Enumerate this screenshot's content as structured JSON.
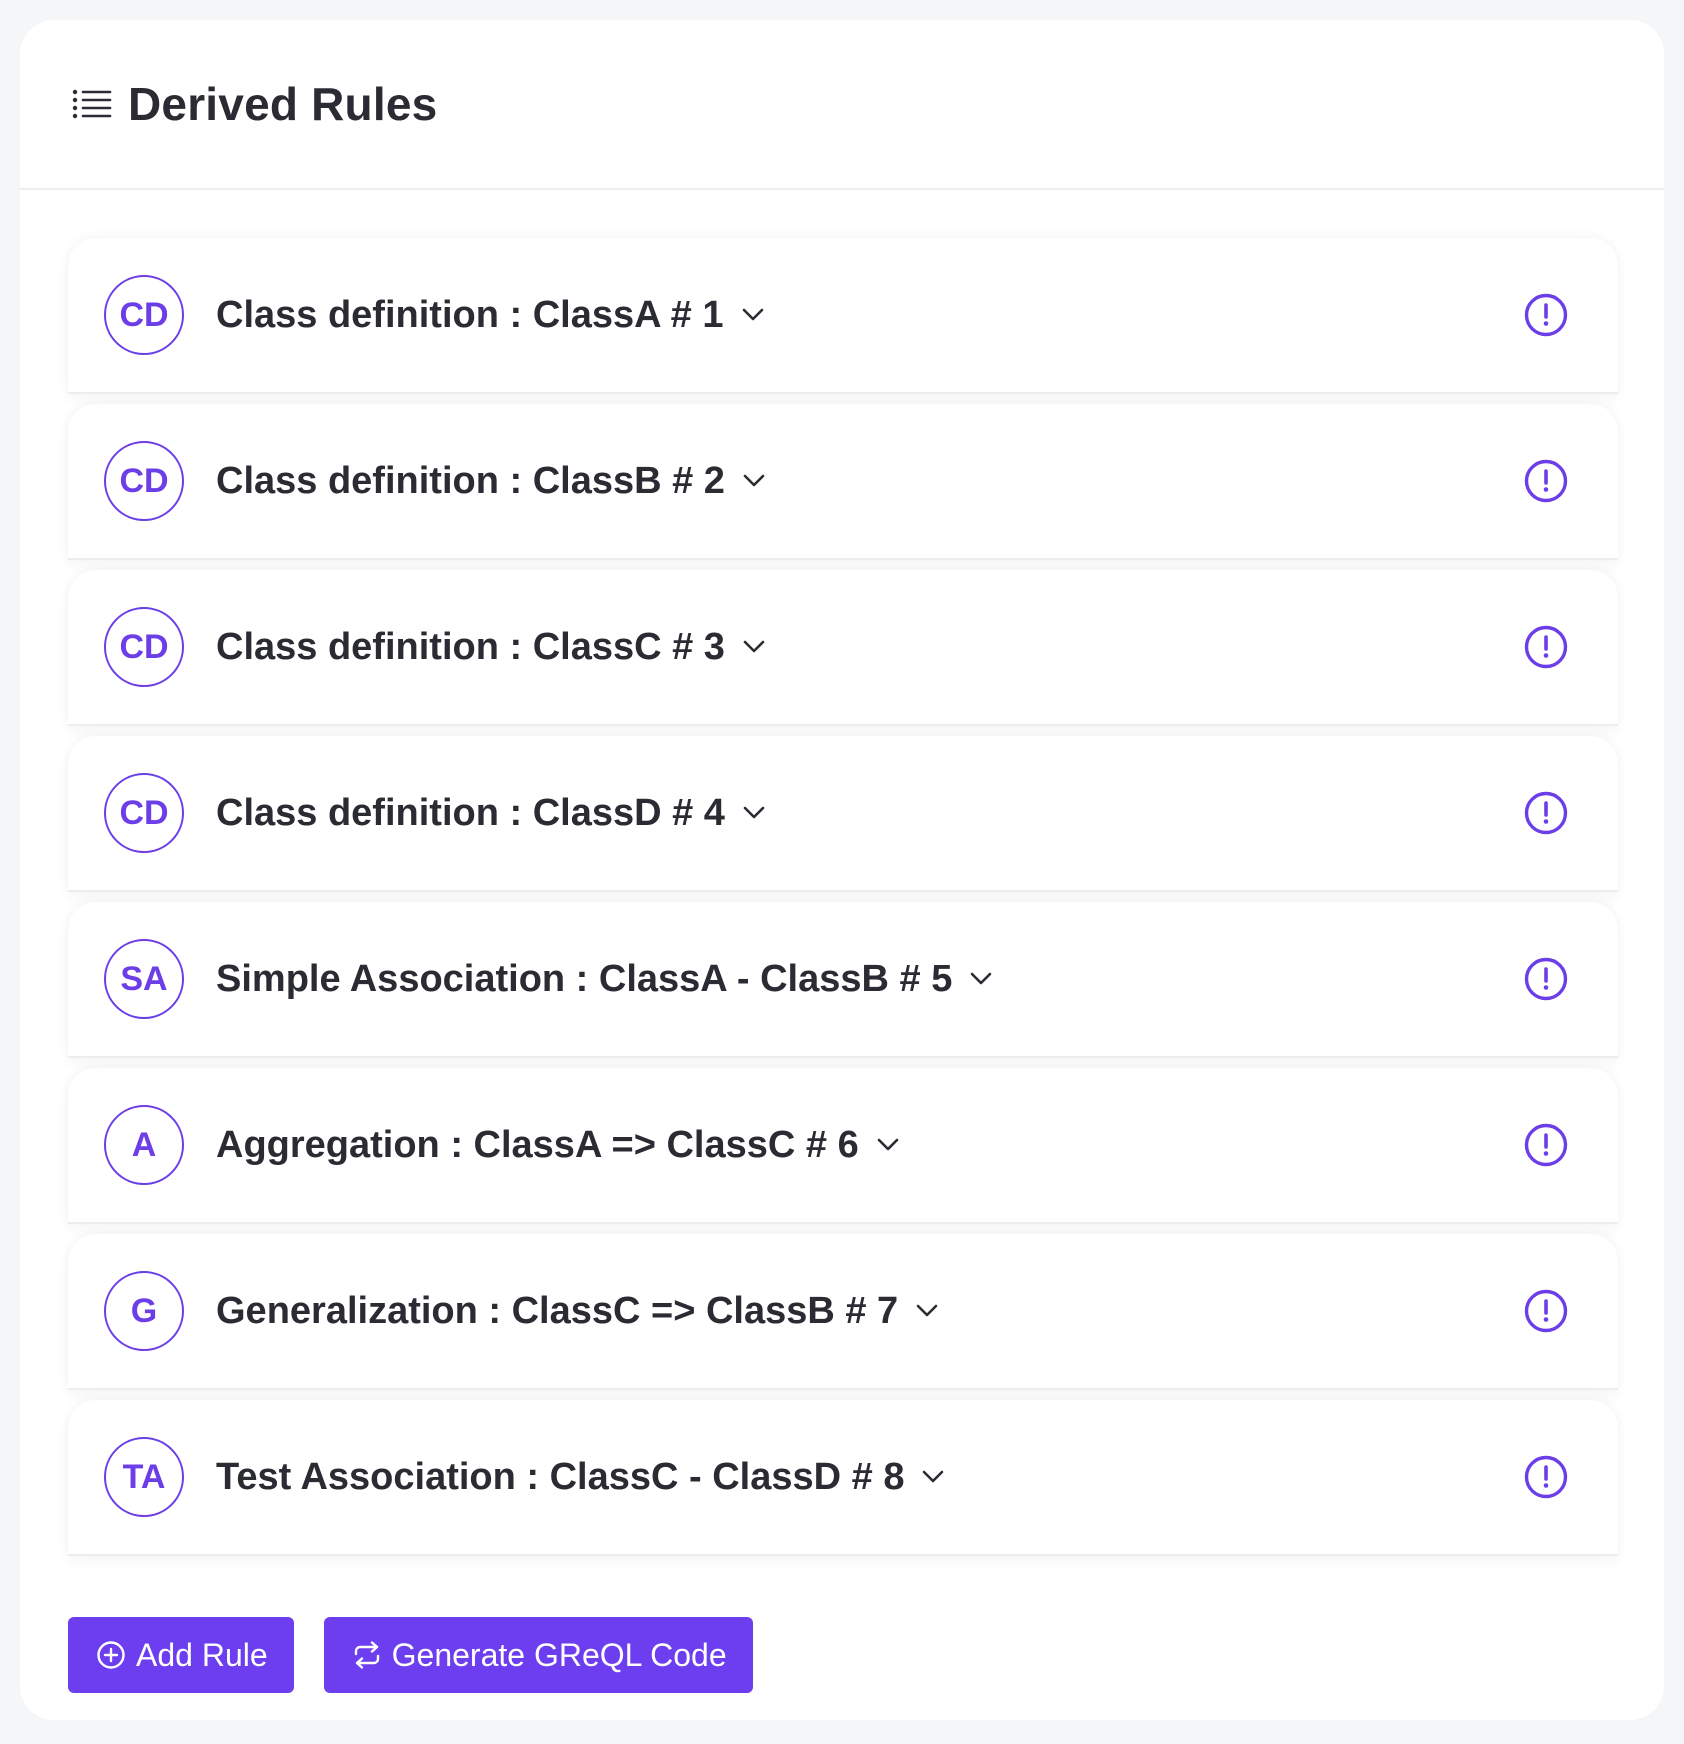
{
  "header": {
    "title": "Derived Rules",
    "icon": "list-icon"
  },
  "rules": [
    {
      "badge": "CD",
      "label": "Class definition : ClassA # 1"
    },
    {
      "badge": "CD",
      "label": "Class definition : ClassB # 2"
    },
    {
      "badge": "CD",
      "label": "Class definition : ClassC # 3"
    },
    {
      "badge": "CD",
      "label": "Class definition : ClassD # 4"
    },
    {
      "badge": "SA",
      "label": "Simple Association : ClassA - ClassB # 5"
    },
    {
      "badge": "A",
      "label": "Aggregation : ClassA => ClassC # 6"
    },
    {
      "badge": "G",
      "label": "Generalization : ClassC => ClassB # 7"
    },
    {
      "badge": "TA",
      "label": "Test Association : ClassC - ClassD # 8"
    }
  ],
  "actions": {
    "add_rule_label": "Add Rule",
    "generate_label": "Generate GReQL Code"
  },
  "colors": {
    "accent": "#6c3ee8",
    "button": "#6c3ef0",
    "text": "#2b2c33",
    "background": "#f5f6f8"
  }
}
